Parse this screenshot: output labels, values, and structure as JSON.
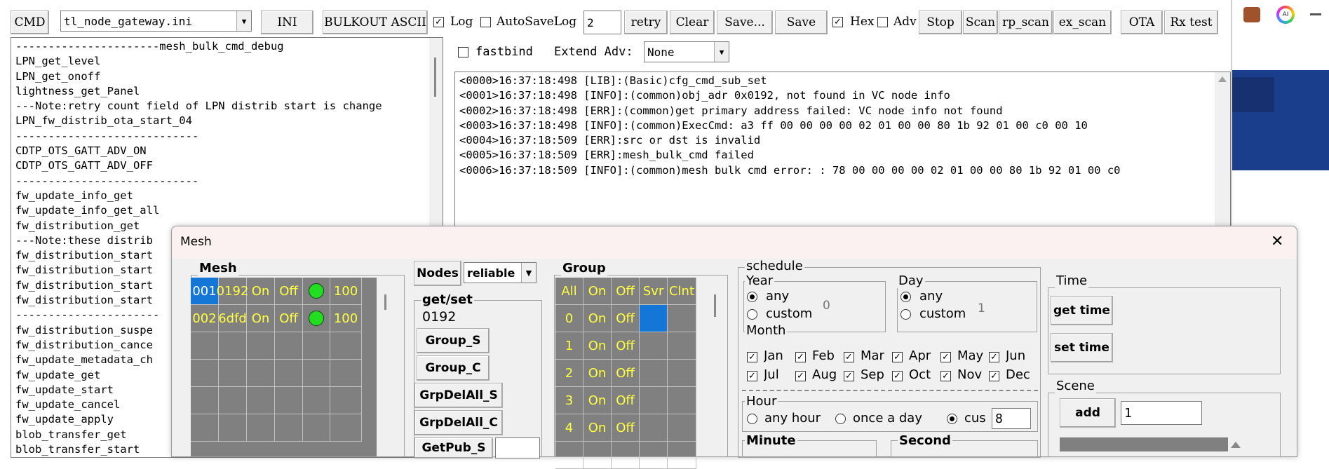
{
  "toolbar": {
    "cmd_label": "CMD",
    "ini_file": "tl_node_gateway.ini",
    "ini_label": "INI",
    "bulkout_label": "BULKOUT ASCII",
    "log_label": "Log",
    "autosave_label": "AutoSaveLog",
    "retry_value": "2",
    "retry_label": "retry",
    "clear_label": "Clear",
    "saveas_label": "Save...",
    "save_label": "Save",
    "hex_label": "Hex",
    "adv_label": "Adv",
    "stop_label": "Stop",
    "scan_label": "Scan",
    "rp_scan_label": "rp_scan",
    "ex_scan_label": "ex_scan",
    "ota_label": "OTA",
    "rxtest_label": "Rx test",
    "check_mark": "✓"
  },
  "options": {
    "fastbind_label": "fastbind",
    "extend_adv_label": "Extend Adv:",
    "extend_adv_value": "None"
  },
  "cmd_list": [
    "----------------------mesh_bulk_cmd_debug",
    "LPN_get_level",
    "LPN_get_onoff",
    "lightness_get_Panel",
    "---Note:retry count field of LPN distrib start is change",
    "LPN_fw_distrib_ota_start_04",
    "----------------------------",
    "CDTP_OTS_GATT_ADV_ON",
    "CDTP_OTS_GATT_ADV_OFF",
    "----------------------------",
    "fw_update_info_get",
    "fw_update_info_get_all",
    "fw_distribution_get",
    "---Note:these distrib",
    "fw_distribution_start",
    "fw_distribution_start",
    "fw_distribution_start",
    "fw_distribution_start",
    "----------------------",
    "fw_distribution_suspe",
    "fw_distribution_cance",
    "fw_update_metadata_ch",
    "fw_update_get",
    "fw_update_start",
    "fw_update_cancel",
    "fw_update_apply",
    "blob_transfer_get",
    "blob_transfer_start"
  ],
  "log_lines": [
    "<0000>16:37:18:498 [LIB]:(Basic)cfg_cmd_sub_set",
    "<0001>16:37:18:498 [INFO]:(common)obj_adr 0x0192, not found in VC node info",
    "<0002>16:37:18:498 [ERR]:(common)get primary address failed: VC node info not found",
    "<0003>16:37:18:498 [INFO]:(common)ExecCmd: a3 ff 00 00 00 00 02 01 00 00 80 1b 92 01 00 c0 00 10",
    "<0004>16:37:18:509 [ERR]:src or dst is invalid",
    "<0005>16:37:18:509 [ERR]:mesh_bulk_cmd failed",
    "<0006>16:37:18:509 [INFO]:(common)mesh bulk cmd error: : 78 00 00 00 00 02 01 00 00 80 1b 92 01 00 c0"
  ],
  "mesh_dialog": {
    "title": "Mesh",
    "close_glyph": "✕",
    "mesh_group_title": "Mesh",
    "nodes": [
      {
        "id": "001",
        "addr": "0192",
        "on": "On",
        "off": "Off",
        "level": "100"
      },
      {
        "id": "002",
        "addr": "6dfd",
        "on": "On",
        "off": "Off",
        "level": "100"
      }
    ],
    "nodes_label": "Nodes",
    "reliable_value": "reliable",
    "getset_title": "get/set",
    "getset_addr": "0192",
    "group_s_label": "Group_S",
    "group_c_label": "Group_C",
    "grpdelall_s_label": "GrpDelAll_S",
    "grpdelall_c_label": "GrpDelAll_C",
    "getpub_s_label": "GetPub_S",
    "group_title": "Group",
    "group_headers": [
      "All",
      "On",
      "Off",
      "Svr",
      "Clnt"
    ],
    "group_rows": [
      {
        "id": "0",
        "on": "On",
        "off": "Off"
      },
      {
        "id": "1",
        "on": "On",
        "off": "Off"
      },
      {
        "id": "2",
        "on": "On",
        "off": "Off"
      },
      {
        "id": "3",
        "on": "On",
        "off": "Off"
      },
      {
        "id": "4",
        "on": "On",
        "off": "Off"
      }
    ],
    "schedule": {
      "title": "schedule",
      "year_title": "Year",
      "year_any": "any",
      "year_custom": "custom",
      "year_value": "0",
      "day_title": "Day",
      "day_any": "any",
      "day_custom": "custom",
      "day_value": "1",
      "month_title": "Month",
      "months_row1": [
        "Jan",
        "Feb",
        "Mar",
        "Apr",
        "May",
        "Jun"
      ],
      "months_row2": [
        "Jul",
        "Aug",
        "Sep",
        "Oct",
        "Nov",
        "Dec"
      ],
      "hour_title": "Hour",
      "hour_any": "any hour",
      "hour_once": "once a day",
      "hour_cus": "cus",
      "hour_value": "8",
      "minute_title": "Minute",
      "second_title": "Second"
    },
    "time_title": "Time",
    "get_time_label": "get time",
    "set_time_label": "set time",
    "scene_title": "Scene",
    "add_label": "add",
    "scene_value": "1"
  },
  "taskbar": {
    "ai_label": "AI"
  }
}
